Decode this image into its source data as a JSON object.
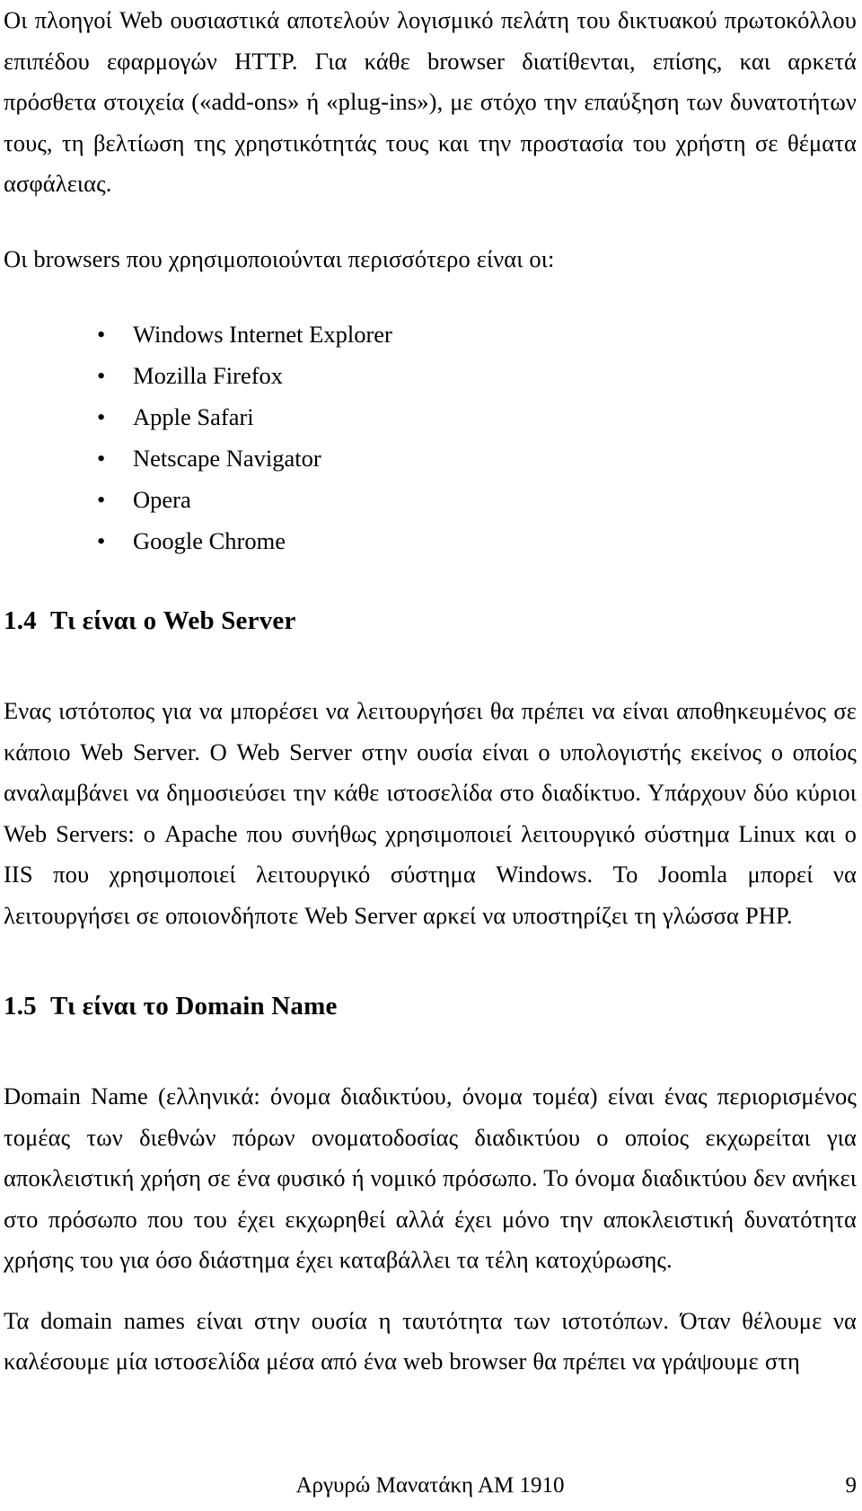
{
  "document": {
    "language": "el",
    "page_number": "9",
    "footer": {
      "author_line": "Αργυρώ Μανατάκη ΑΜ 1910",
      "page_label": "9"
    }
  },
  "body": {
    "intro_paragraph": "Οι πλοηγοί Web ουσιαστικά αποτελούν λογισμικό πελάτη του δικτυακού πρωτοκόλλου επιπέδου εφαρμογών HTTP. Για κάθε browser διατίθενται, επίσης, και αρκετά πρόσθετα στοιχεία («add-ons» ή «plug-ins»), με στόχο την επαύξηση των δυνατοτήτων τους, τη βελτίωση της χρηστικότητάς τους και την προστασία του χρήστη σε θέματα ασφάλειας.",
    "list_lead_in": "Οι browsers που χρησιμοποιούνται περισσότερο είναι οι:",
    "browser_list": [
      {
        "bullet": "•",
        "label": "Windows Internet Explorer"
      },
      {
        "bullet": "•",
        "label": "Mozilla Firefox"
      },
      {
        "bullet": "•",
        "label": "Apple Safari"
      },
      {
        "bullet": "•",
        "label": "Netscape Navigator"
      },
      {
        "bullet": "•",
        "label": "Opera"
      },
      {
        "bullet": "•",
        "label": "Google Chrome"
      }
    ]
  },
  "sections": [
    {
      "number": "1.4",
      "title": "Τι είναι ο Web Server",
      "paragraphs": [
        "Ενας ιστότοπος για να μπορέσει να λειτουργήσει θα πρέπει να είναι αποθηκευμένος σε κάποιο Web Server. Ο Web Server στην ουσία είναι ο  υπολογιστής εκείνος ο οποίος αναλαμβάνει να δημοσιεύσει την κάθε ιστοσελίδα στο διαδίκτυο. Υπάρχουν δύο κύριοι Web Servers: ο Apache που συνήθως χρησιμοποιεί λειτουργικό σύστημα Linux και ο IIS που  χρησιμοποιεί  λειτουργικό  σύστημα Windows. Το Joomla μπορεί να λειτουργήσει σε οποιονδήποτε Web Server αρκεί να υποστηρίζει τη γλώσσα PHP."
      ]
    },
    {
      "number": "1.5",
      "title": "Τι είναι το Domain Name",
      "paragraphs": [
        "Domain Name (ελληνικά: όνομα διαδικτύου, όνομα τομέα) είναι ένας περιορισμένος τομέας των διεθνών πόρων ονοματοδοσίας διαδικτύου ο οποίος εκχωρείται για αποκλειστική χρήση σε ένα φυσικό ή νομικό πρόσωπο. Το όνομα διαδικτύου δεν ανήκει στο πρόσωπο που του έχει εκχωρηθεί αλλά έχει μόνο την αποκλειστική δυνατότητα χρήσης του για όσο διάστημα έχει καταβάλλει τα τέλη κατοχύρωσης.",
        "Τα domain names είναι στην ουσία η ταυτότητα των ιστοτόπων.  Όταν θέλουμε να καλέσουμε μία ιστοσελίδα  μέσα  από  ένα web browser θα πρέπει να  γράψουμε στη"
      ]
    }
  ]
}
